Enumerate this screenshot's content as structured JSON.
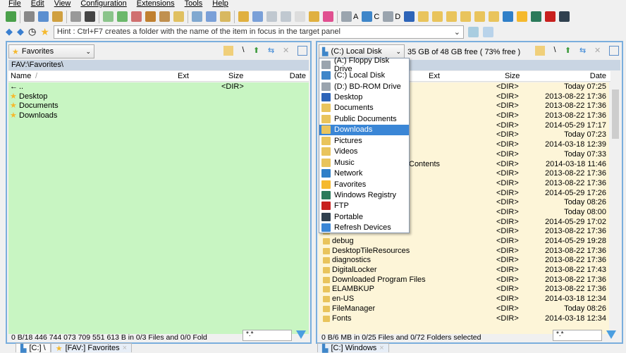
{
  "menu": [
    "File",
    "Edit",
    "View",
    "Configuration",
    "Extensions",
    "Tools",
    "Help"
  ],
  "toolbar": {
    "drive_a": "A",
    "drive_c": "C",
    "drive_d": "D"
  },
  "hint": "Hint : Ctrl+F7 creates a folder with the name of the item in focus in the target panel",
  "left": {
    "drive": "Favorites",
    "path": "FAV:\\Favorites\\",
    "columns": {
      "name": "Name",
      "sort": "/",
      "ext": "Ext",
      "size": "Size",
      "date": "Date"
    },
    "rows": [
      {
        "name": "..",
        "size": "<DIR>",
        "up": true
      },
      {
        "name": "Desktop",
        "size": ""
      },
      {
        "name": "Documents",
        "size": ""
      },
      {
        "name": "Downloads",
        "size": ""
      }
    ],
    "status": "0 B/18 446 744 073 709 551 613 B in 0/3 Files and 0/0 Fold",
    "filter": "*.*",
    "tabs": [
      "[C:] \\",
      "[FAV:] Favorites"
    ]
  },
  "right": {
    "drive": "(C:) Local Disk",
    "free": "35 GB of 48 GB free ( 73% free )",
    "columns": {
      "ext": "Ext",
      "size": "Size",
      "date": "Date"
    },
    "rows": [
      {
        "name": "",
        "size": "<DIR>",
        "date": "Today 07:25"
      },
      {
        "name": "",
        "size": "<DIR>",
        "date": "2013-08-22 17:36"
      },
      {
        "name": "",
        "size": "<DIR>",
        "date": "2013-08-22 17:36"
      },
      {
        "name": "",
        "size": "<DIR>",
        "date": "2013-08-22 17:36"
      },
      {
        "name": "",
        "size": "<DIR>",
        "date": "2014-05-29 17:17"
      },
      {
        "name": "",
        "size": "<DIR>",
        "date": "Today 07:23"
      },
      {
        "name": "",
        "size": "<DIR>",
        "date": "2014-03-18 12:39"
      },
      {
        "name": "",
        "size": "<DIR>",
        "date": "Today 07:33"
      },
      {
        "name": "Contents",
        "size": "<DIR>",
        "date": "2014-03-18 11:46",
        "partial": true
      },
      {
        "name": "",
        "size": "<DIR>",
        "date": "2013-08-22 17:36"
      },
      {
        "name": "",
        "size": "<DIR>",
        "date": "2013-08-22 17:36"
      },
      {
        "name": "",
        "size": "<DIR>",
        "date": "2014-05-29 17:26"
      },
      {
        "name": "",
        "size": "<DIR>",
        "date": "Today 08:26"
      },
      {
        "name": "",
        "size": "<DIR>",
        "date": "Today 08:00"
      },
      {
        "name": "",
        "size": "<DIR>",
        "date": "2014-05-29 17:02"
      },
      {
        "name": "",
        "size": "<DIR>",
        "date": "2013-08-22 17:36"
      },
      {
        "name": "debug",
        "size": "<DIR>",
        "date": "2014-05-29 19:28"
      },
      {
        "name": "DesktopTileResources",
        "size": "<DIR>",
        "date": "2013-08-22 17:36"
      },
      {
        "name": "diagnostics",
        "size": "<DIR>",
        "date": "2013-08-22 17:36"
      },
      {
        "name": "DigitalLocker",
        "size": "<DIR>",
        "date": "2013-08-22 17:43"
      },
      {
        "name": "Downloaded Program Files",
        "size": "<DIR>",
        "date": "2013-08-22 17:36"
      },
      {
        "name": "ELAMBKUP",
        "size": "<DIR>",
        "date": "2013-08-22 17:36"
      },
      {
        "name": "en-US",
        "size": "<DIR>",
        "date": "2014-03-18 12:34"
      },
      {
        "name": "FileManager",
        "size": "<DIR>",
        "date": "Today 08:26"
      },
      {
        "name": "Fonts",
        "size": "<DIR>",
        "date": "2014-03-18 12:34"
      }
    ],
    "status": "0 B/6 MB in 0/25 Files and 0/72 Folders selected",
    "filter": "*.*",
    "tabs": [
      "[C:] Windows"
    ]
  },
  "dropdown": {
    "selected": "Downloads",
    "items": [
      {
        "label": "(A:) Floppy Disk Drive",
        "color": "#9aa4ae"
      },
      {
        "label": "(C:) Local Disk",
        "color": "#3f86c9"
      },
      {
        "label": "(D:) BD-ROM Drive",
        "color": "#9aa4ae"
      },
      {
        "label": "Desktop",
        "color": "#2d64b8"
      },
      {
        "label": "Documents",
        "color": "#e9c45c"
      },
      {
        "label": "Public Documents",
        "color": "#e9c45c"
      },
      {
        "label": "Downloads",
        "color": "#e9c45c"
      },
      {
        "label": "Pictures",
        "color": "#e9c45c"
      },
      {
        "label": "Videos",
        "color": "#e9c45c"
      },
      {
        "label": "Music",
        "color": "#e9c45c"
      },
      {
        "label": "Network",
        "color": "#2f7fc8"
      },
      {
        "label": "Favorites",
        "color": "#f5b92e"
      },
      {
        "label": "Windows Registry",
        "color": "#2b7a5a"
      },
      {
        "label": "FTP",
        "color": "#c8201e"
      },
      {
        "label": "Portable",
        "color": "#30404f"
      },
      {
        "label": "Refresh Devices",
        "color": "#3a86d6"
      }
    ]
  },
  "colors": {
    "left_bg": "#c8f5c2",
    "right_bg": "#fdf5d8",
    "accent": "#3a86d6"
  }
}
